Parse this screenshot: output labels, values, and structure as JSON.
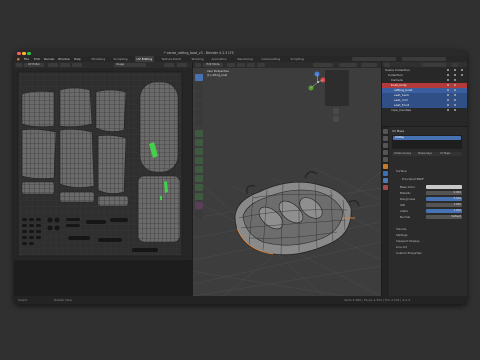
{
  "window": {
    "title": "* canoe_rafting_boat_v3 - Blender 4.2.3 LTS"
  },
  "menu": [
    "File",
    "Edit",
    "Render",
    "Window",
    "Help"
  ],
  "workspaces": [
    "Modeling",
    "Sculpting",
    "UV Editing",
    "Texture Paint",
    "Shading",
    "Animation",
    "Rendering",
    "Compositing",
    "Scripting"
  ],
  "active_workspace": "UV Editing",
  "uv_editor": {
    "mode": "UV Editor",
    "image_name": "Image"
  },
  "viewport": {
    "mode": "Edit Mode",
    "view_label": "User Perspective",
    "object_label": "(1) rafting_boat"
  },
  "outliner": {
    "title": "Scene Collection",
    "rows": [
      {
        "label": "Scene Collection",
        "selected": false
      },
      {
        "label": "Collection",
        "selected": false
      },
      {
        "label": "Camera",
        "selected": false
      },
      {
        "label": "boat_body",
        "selected": true
      },
      {
        "label": "rafting_boat",
        "selected": false
      },
      {
        "label": "seat_back",
        "selected": false
      },
      {
        "label": "seat_mid",
        "selected": false
      },
      {
        "label": "seat_front",
        "selected": false
      },
      {
        "label": "rope_handles",
        "selected": false
      }
    ]
  },
  "properties": {
    "header": "UV Maps",
    "uv_map": "UVMap",
    "tabs": [
      "Vertex Groups",
      "Shape Keys",
      "UV Maps"
    ],
    "sections": [
      "Surface",
      "Volume",
      "Settings",
      "Viewport Display",
      "Line Art",
      "Custom Properties"
    ],
    "material": "Principled BSDF",
    "fields": [
      {
        "label": "Base Color",
        "value": ""
      },
      {
        "label": "Metallic",
        "value": "0.000"
      },
      {
        "label": "Roughness",
        "value": "0.500"
      },
      {
        "label": "IOR",
        "value": "1.500"
      },
      {
        "label": "Alpha",
        "value": "1.000"
      },
      {
        "label": "Normal",
        "value": "Default"
      }
    ]
  },
  "status": {
    "left": "Select",
    "mid": "Rotate View",
    "right": "Verts 2,480 | Faces 2,352 | Tris 4,704 | 4.2.3"
  },
  "colors": {
    "accent": "#4772b3",
    "selected_row": "#b33a3a",
    "uv_highlight": "#44d04a",
    "desktop": "#303030"
  }
}
